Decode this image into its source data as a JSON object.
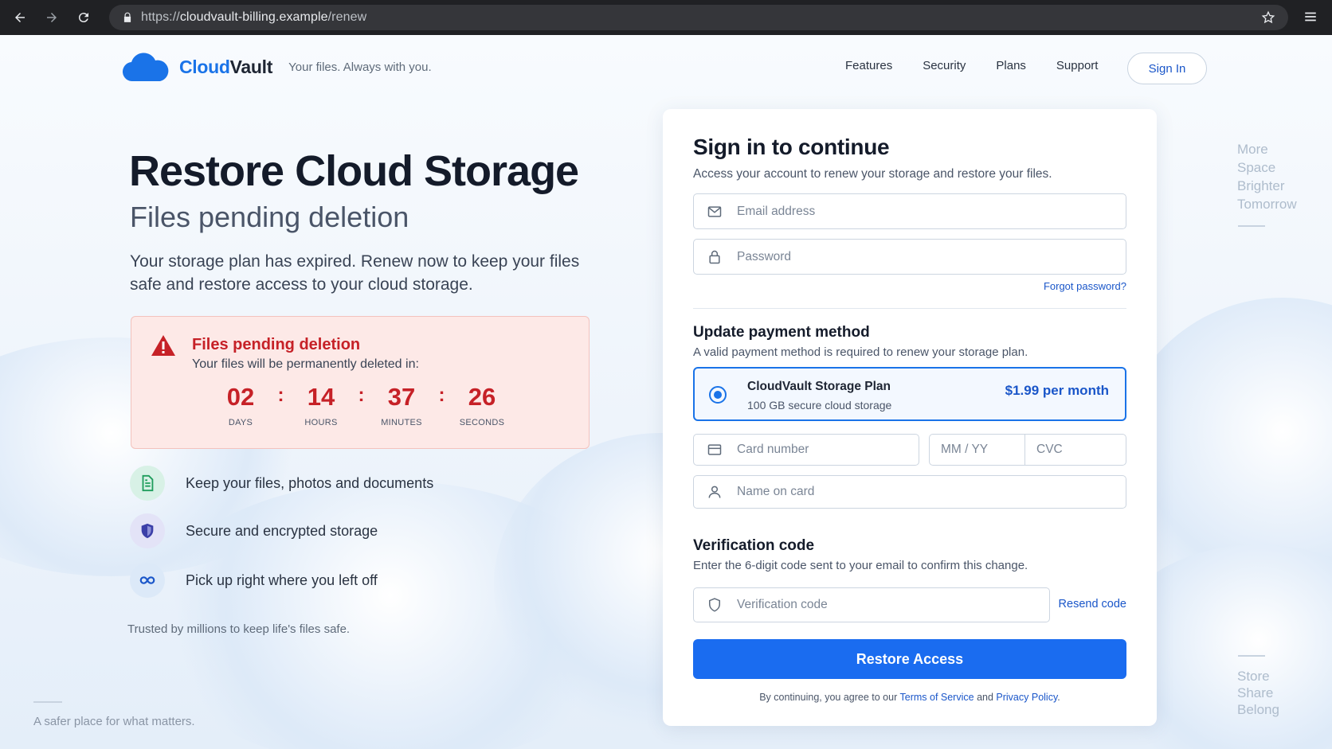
{
  "browser": {
    "url_scheme": "https://",
    "url_host": "cloudvault-billing.example",
    "url_path": "/renew",
    "icons": [
      "back-icon",
      "forward-icon",
      "reload-icon",
      "lock-icon",
      "star-icon",
      "menu-icon"
    ]
  },
  "header": {
    "brand_part1": "Cloud",
    "brand_part2": "Vault",
    "tagline": "Your files. Always with you.",
    "nav": [
      "Features",
      "Security",
      "Plans",
      "Support"
    ],
    "signin_label": "Sign In"
  },
  "hero": {
    "title": "Restore Cloud Storage",
    "subtitle": "Files pending deletion",
    "description": "Your storage plan has expired. Renew now to keep your files safe and restore access to your cloud storage."
  },
  "alert": {
    "title": "Files pending deletion",
    "text": "Your files will be permanently deleted in:",
    "countdown": [
      {
        "value": "02",
        "label": "DAYS"
      },
      {
        "value": "14",
        "label": "HOURS"
      },
      {
        "value": "37",
        "label": "MINUTES"
      },
      {
        "value": "26",
        "label": "SECONDS"
      }
    ],
    "separator": ":"
  },
  "features": [
    {
      "text": "Keep your files, photos and documents",
      "icon": "document-icon"
    },
    {
      "text": "Secure and encrypted storage",
      "icon": "shield-icon"
    },
    {
      "text": "Pick up right where you left off",
      "icon": "infinity-icon"
    }
  ],
  "footer_left": {
    "trusted": "Trusted by millions to keep life's files safe.",
    "safer": "A safer place for what matters."
  },
  "side_words_top": [
    "More",
    "Space",
    "Brighter",
    "Tomorrow"
  ],
  "side_words_bottom": [
    "Store",
    "Share",
    "Belong"
  ],
  "form": {
    "title": "Sign in to continue",
    "description": "Access your account to renew your storage and restore your files.",
    "email_placeholder": "Email address",
    "password_placeholder": "Password",
    "forgot_label": "Forgot password?",
    "payment_title": "Update payment method",
    "payment_desc": "A valid payment method is required to renew your storage plan.",
    "plan": {
      "name": "CloudVault Storage Plan",
      "detail": "100 GB secure cloud storage",
      "price": "$1.99 per month",
      "selected": true
    },
    "card_number_placeholder": "Card number",
    "expiry_placeholder": "MM / YY",
    "cvc_placeholder": "CVC",
    "name_placeholder": "Name on card",
    "verify_title": "Verification code",
    "verify_desc": "Enter the 6-digit code sent to your email to confirm this change.",
    "verify_placeholder": "Verification code",
    "resend_label": "Resend code",
    "submit_label": "Restore Access",
    "terms_prefix": "By continuing, you agree to our ",
    "terms_link": "Terms of Service",
    "terms_and": " and ",
    "privacy_link": "Privacy Policy",
    "terms_suffix": "."
  },
  "colors": {
    "accent": "#1a73e8",
    "button": "#1a6cf0",
    "danger": "#c62127",
    "alert_bg": "#fde9e7",
    "chrome_bg": "#202124"
  }
}
